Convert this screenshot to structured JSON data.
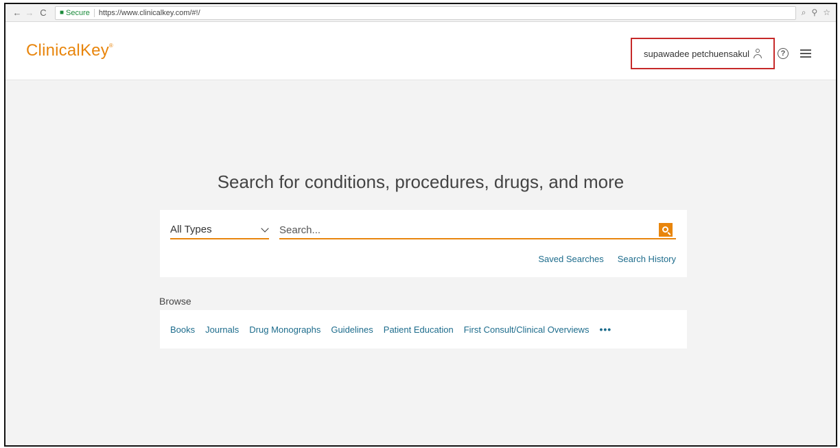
{
  "browser": {
    "secure_label": "Secure",
    "url": "https://www.clinicalkey.com/#!/"
  },
  "header": {
    "logo": "ClinicalKey",
    "logo_mark": "®",
    "user_name": "supawadee petchuensakul",
    "help_icon_glyph": "?"
  },
  "main": {
    "title": "Search for conditions, procedures, drugs, and more",
    "search": {
      "type_selected": "All Types",
      "placeholder": "Search...",
      "saved_searches": "Saved Searches",
      "search_history": "Search History"
    },
    "browse": {
      "label": "Browse",
      "items": [
        "Books",
        "Journals",
        "Drug Monographs",
        "Guidelines",
        "Patient Education",
        "First Consult/Clinical Overviews"
      ],
      "more": "•••"
    }
  },
  "colors": {
    "accent": "#e8850c",
    "link": "#1d6c8c",
    "highlight_box": "#c62828"
  }
}
